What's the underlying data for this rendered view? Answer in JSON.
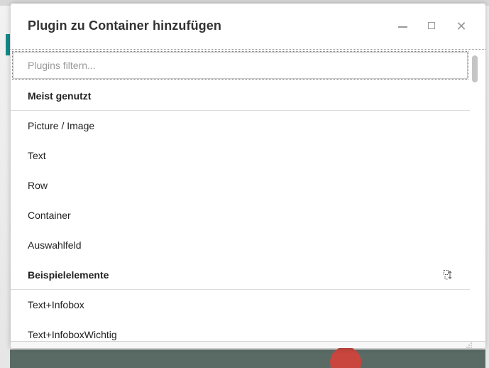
{
  "dialog": {
    "title": "Plugin zu Container hinzufügen",
    "controls": {
      "minimize": "minimize-icon",
      "maximize": "maximize-icon",
      "close": "close-icon"
    }
  },
  "filter": {
    "placeholder": "Plugins filtern...",
    "value": ""
  },
  "groups": [
    {
      "label": "Meist genutzt",
      "items": [
        "Picture / Image",
        "Text",
        "Row",
        "Container",
        "Auswahlfeld"
      ]
    },
    {
      "label": "Beispielelemente",
      "icon": "drag-move-icon",
      "items": [
        "Text+Infobox",
        "Text+InfoboxWichtig"
      ]
    }
  ],
  "colors": {
    "accent": "#118a8a",
    "background_red": "#c8463e"
  }
}
